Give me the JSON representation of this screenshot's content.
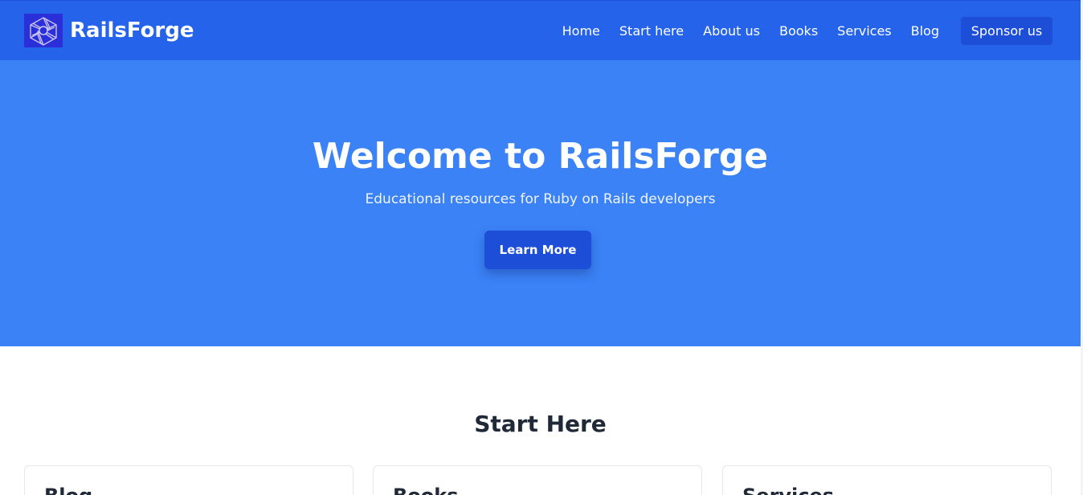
{
  "navbar": {
    "brand": "RailsForge",
    "links": [
      "Home",
      "Start here",
      "About us",
      "Books",
      "Services",
      "Blog"
    ],
    "sponsor_label": "Sponsor us"
  },
  "hero": {
    "title": "Welcome to RailsForge",
    "subtitle": "Educational resources for Ruby on Rails developers",
    "cta_label": "Learn More"
  },
  "start_here": {
    "title": "Start Here",
    "cards": [
      "Blog",
      "Books",
      "Services"
    ]
  },
  "colors": {
    "navbar": "#2563eb",
    "hero": "#3b82f6",
    "button": "#1d4ed8",
    "heading_text": "#1f2937"
  }
}
